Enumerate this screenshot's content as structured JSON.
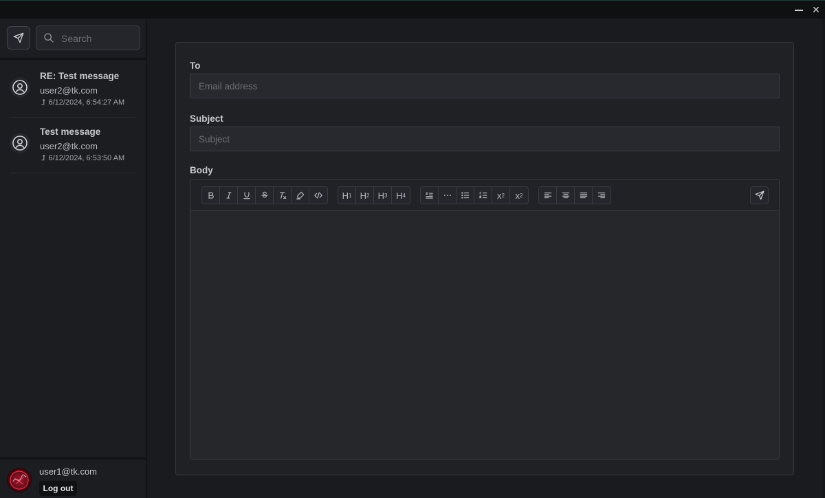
{
  "window": {
    "minimize_icon": "minimize-icon",
    "close_symbol": "✕"
  },
  "sidebar": {
    "compose_icon": "send-icon",
    "search": {
      "placeholder": "Search"
    },
    "messages": [
      {
        "subject": "RE: Test message",
        "from": "user2@tk.com",
        "date": "6/12/2024, 6:54:27 AM",
        "reply_arrow": "⮥"
      },
      {
        "subject": "Test message",
        "from": "user2@tk.com",
        "date": "6/12/2024, 6:53:50 AM",
        "reply_arrow": "⮥"
      }
    ],
    "user": {
      "email": "user1@tk.com",
      "logout_label": "Log out"
    }
  },
  "compose": {
    "to_label": "To",
    "to_placeholder": "Email address",
    "subject_label": "Subject",
    "subject_placeholder": "Subject",
    "body_label": "Body",
    "toolbar": {
      "format": [
        "B",
        "I",
        "U",
        "S",
        "Tx",
        "highlight",
        "code"
      ],
      "headings": [
        "H1",
        "H2",
        "H3",
        "H4"
      ],
      "blocks": [
        "blockquote",
        "hr",
        "bullet-list",
        "ordered-list",
        "subscript",
        "superscript"
      ],
      "align": [
        "align-left",
        "align-center",
        "align-justify",
        "align-right"
      ],
      "sub_label": "x",
      "sub_index": "2",
      "sup_label": "x",
      "sup_index": "2",
      "h1_label": "H",
      "h1_index": "1",
      "h2_label": "H",
      "h2_index": "2",
      "h3_label": "H",
      "h3_index": "3",
      "h4_label": "H",
      "h4_index": "4"
    }
  },
  "colors": {
    "background": "#1a1b1e",
    "sidebar": "#1c1d20",
    "card": "#202125",
    "field": "#28292e",
    "border": "#3a3c42",
    "text": "#c9cacd"
  }
}
